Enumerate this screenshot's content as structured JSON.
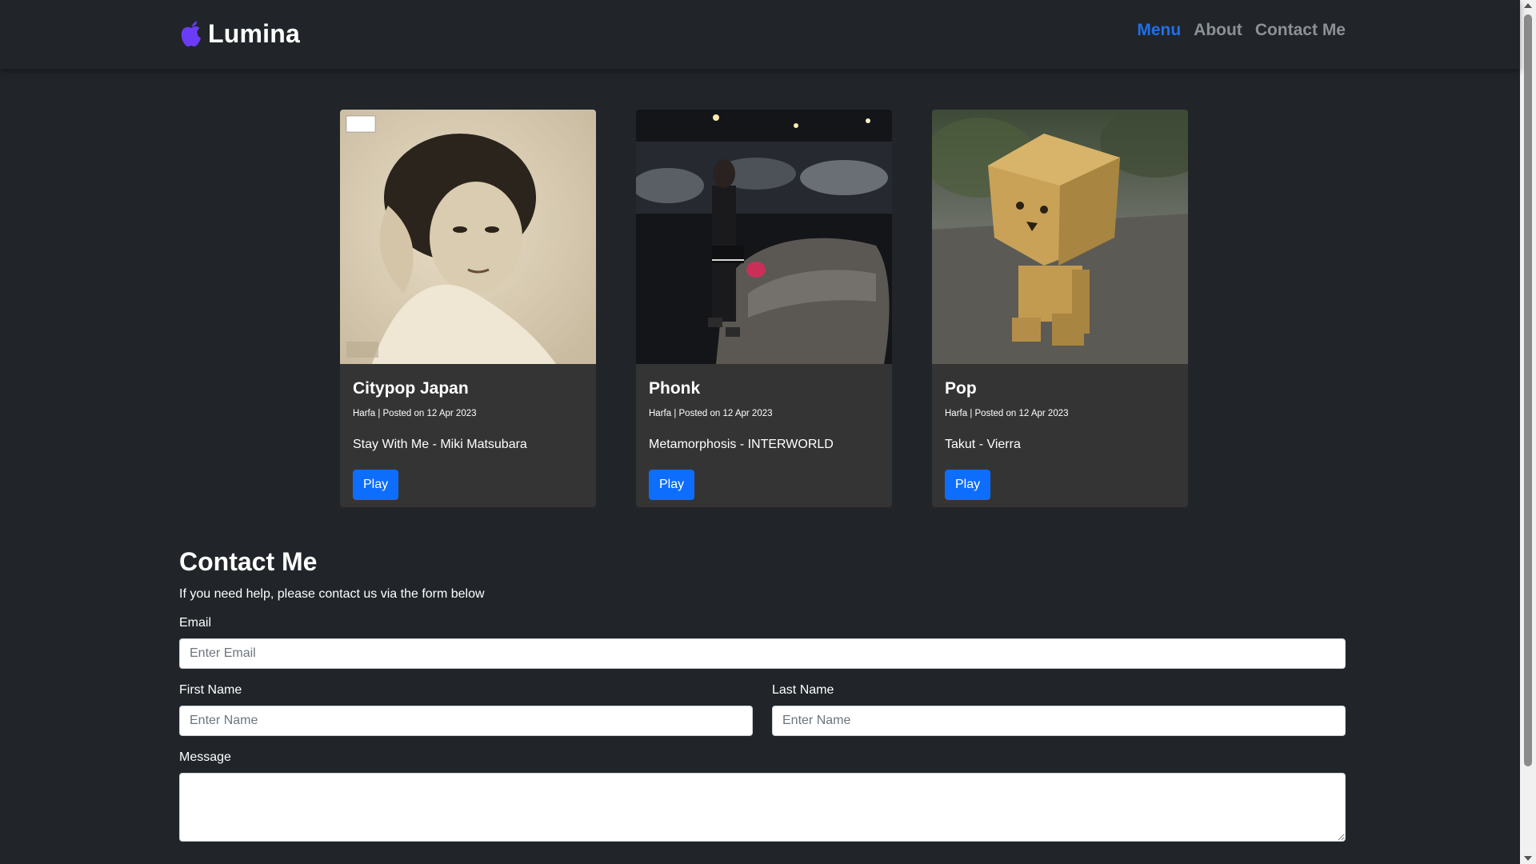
{
  "brand": {
    "name": "Lumina",
    "icon": "apple-icon",
    "icon_color": "#6b3cf5"
  },
  "nav": {
    "items": [
      {
        "label": "Menu",
        "active": true
      },
      {
        "label": "About",
        "active": false
      },
      {
        "label": "Contact Me",
        "active": false
      }
    ]
  },
  "cards": [
    {
      "title": "Citypop Japan",
      "meta": "Harfa | Posted on 12 Apr 2023",
      "song": "Stay With Me - Miki Matsubara",
      "button": "Play",
      "image": "album-cover-photo"
    },
    {
      "title": "Phonk",
      "meta": "Harfa | Posted on 12 Apr 2023",
      "song": "Metamorphosis - INTERWORLD",
      "button": "Play",
      "image": "night-car-photo"
    },
    {
      "title": "Pop",
      "meta": "Harfa | Posted on 12 Apr 2023",
      "song": "Takut - Vierra",
      "button": "Play",
      "image": "box-robot-photo"
    }
  ],
  "contact": {
    "title": "Contact Me",
    "subtitle": "If you need help, please contact us via the form below",
    "email": {
      "label": "Email",
      "placeholder": "Enter Email",
      "value": ""
    },
    "first_name": {
      "label": "First Name",
      "placeholder": "Enter Name",
      "value": ""
    },
    "last_name": {
      "label": "Last Name",
      "placeholder": "Enter Name",
      "value": ""
    },
    "message": {
      "label": "Message",
      "placeholder": "",
      "value": ""
    }
  },
  "colors": {
    "background": "#212529",
    "card": "#343434",
    "accent": "#0d6efd",
    "nav_active": "#1f6feb",
    "nav_muted": "#8c9197"
  }
}
